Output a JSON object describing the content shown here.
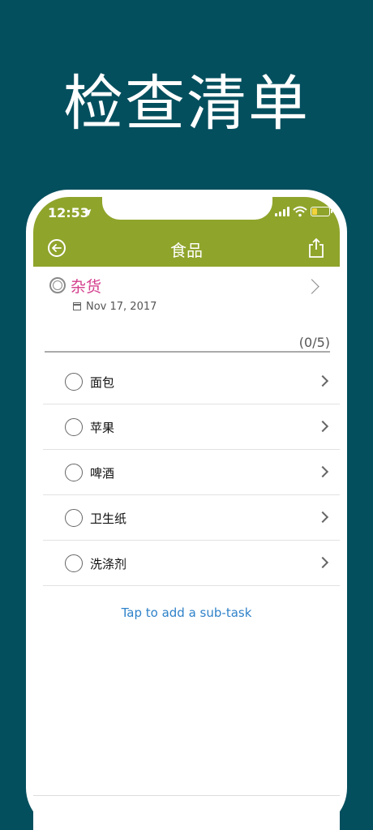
{
  "headline": "检查清单",
  "status_bar": {
    "time": "12:53",
    "location_glyph": "➤"
  },
  "nav": {
    "title": "食品"
  },
  "task": {
    "title": "杂货",
    "date": "Nov 17, 2017"
  },
  "progress": "(0/5)",
  "subtasks": [
    {
      "label": "面包"
    },
    {
      "label": "苹果"
    },
    {
      "label": "啤酒"
    },
    {
      "label": "卫生纸"
    },
    {
      "label": "洗涤剂"
    }
  ],
  "add_subtask": "Tap to add a sub-task",
  "colors": {
    "background": "#044f5e",
    "topbar": "#8fa42b",
    "task_title": "#d43f8d",
    "link": "#2f82c9"
  }
}
